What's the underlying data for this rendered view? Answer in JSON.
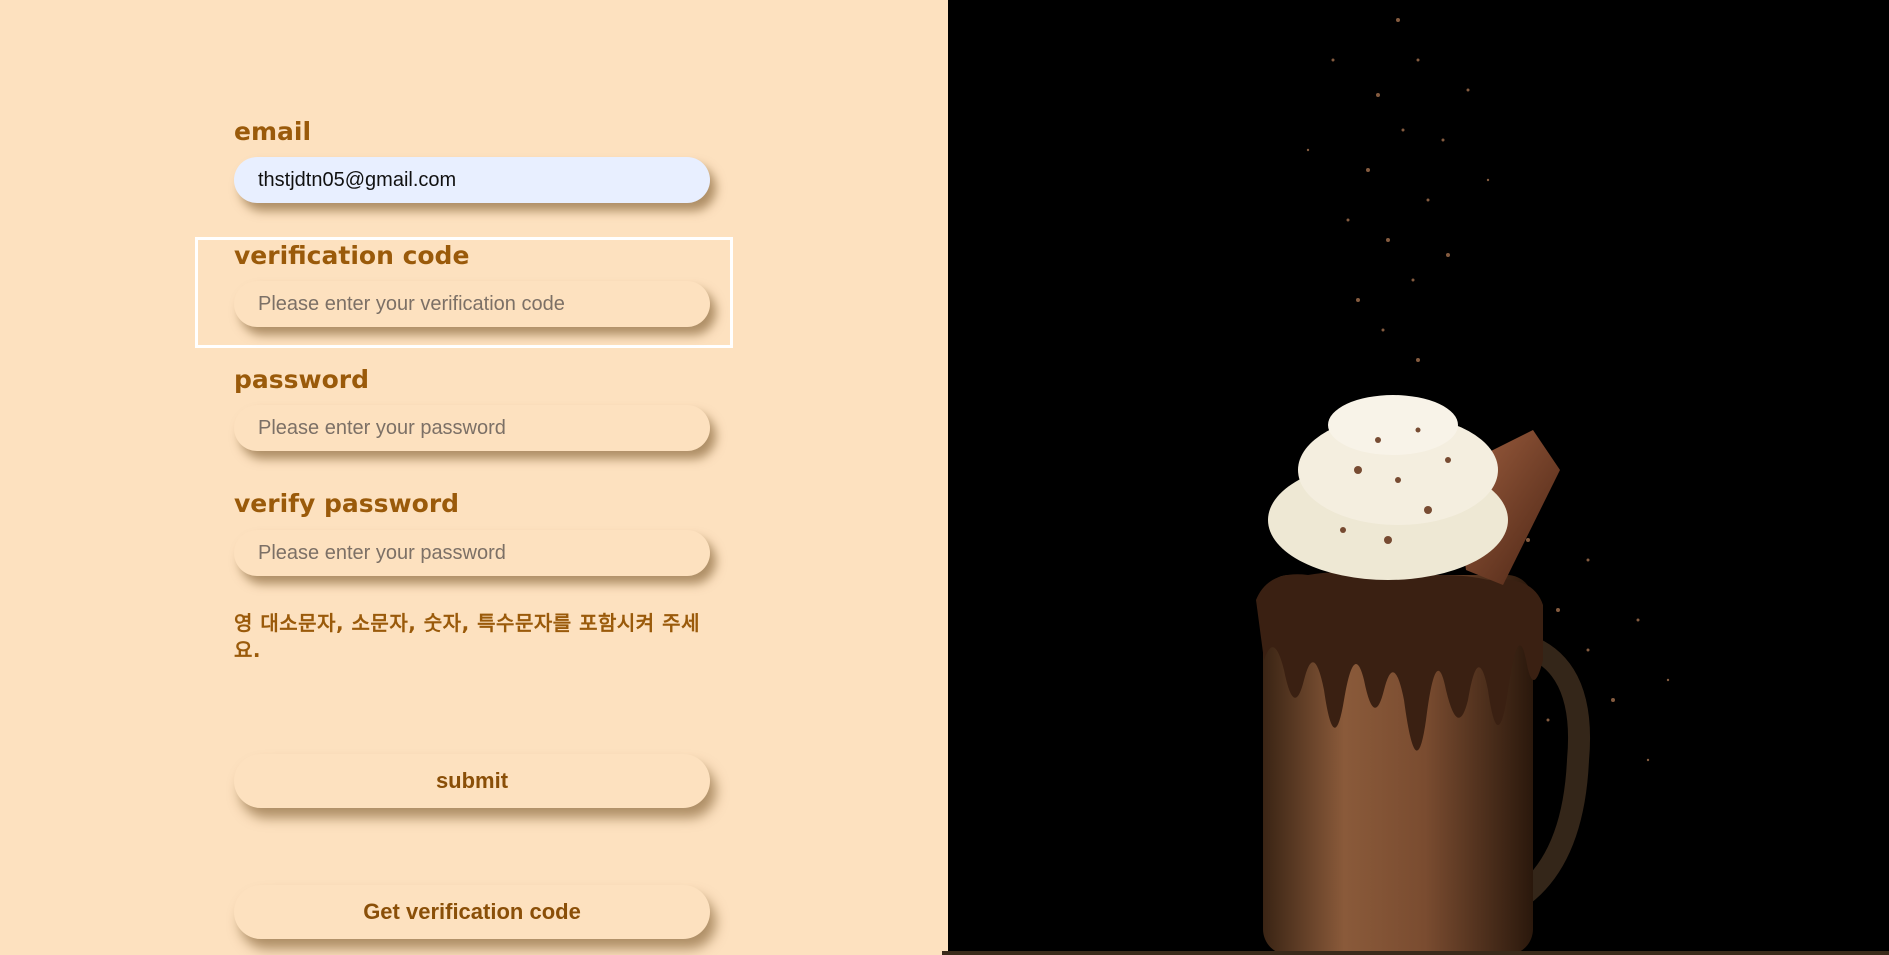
{
  "form": {
    "email": {
      "label": "email",
      "value": "thstjdtn05@gmail.com"
    },
    "verification_code": {
      "label": "verification code",
      "placeholder": "Please enter your verification code"
    },
    "password": {
      "label": "password",
      "placeholder": "Please enter your password"
    },
    "verify_password": {
      "label": "verify password",
      "placeholder": "Please enter your password"
    },
    "hint": "영 대소문자, 소문자, 숫자, 특수문자를 포함시켜 주세요.",
    "submit_label": "submit",
    "get_code_label": "Get verification code"
  },
  "colors": {
    "background": "#fde1bf",
    "label_text": "#9a5a0a",
    "filled_input": "#e8efff",
    "focus_outline": "#ffffff",
    "photo_background": "#000000"
  },
  "image": {
    "subject": "chocolate milkshake"
  }
}
